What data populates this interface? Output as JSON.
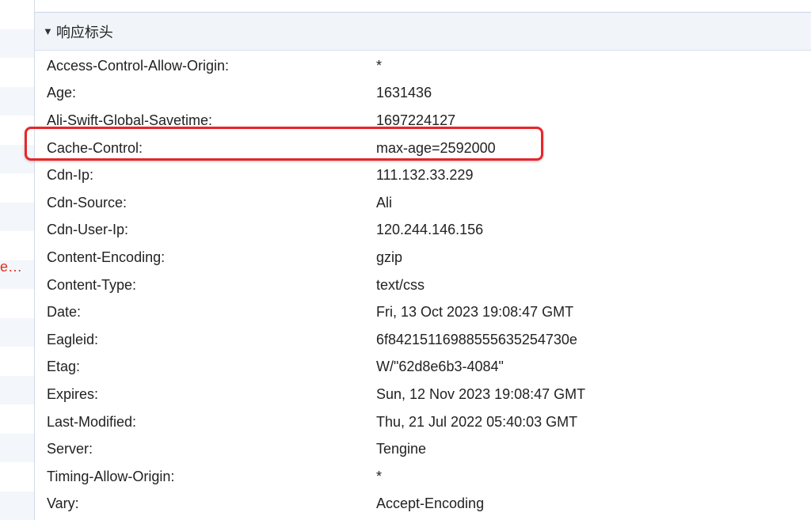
{
  "left_panel": {
    "truncated_text": "e…"
  },
  "section": {
    "title": "响应标头",
    "toggle_icon": "triangle-down-icon"
  },
  "headers": [
    {
      "name": "Access-Control-Allow-Origin:",
      "value": "*"
    },
    {
      "name": "Age:",
      "value": "1631436"
    },
    {
      "name": "Ali-Swift-Global-Savetime:",
      "value": "1697224127"
    },
    {
      "name": "Cache-Control:",
      "value": "max-age=2592000"
    },
    {
      "name": "Cdn-Ip:",
      "value": "111.132.33.229"
    },
    {
      "name": "Cdn-Source:",
      "value": "Ali"
    },
    {
      "name": "Cdn-User-Ip:",
      "value": "120.244.146.156"
    },
    {
      "name": "Content-Encoding:",
      "value": "gzip"
    },
    {
      "name": "Content-Type:",
      "value": "text/css"
    },
    {
      "name": "Date:",
      "value": "Fri, 13 Oct 2023 19:08:47 GMT"
    },
    {
      "name": "Eagleid:",
      "value": "6f842151169885556352547 30e"
    },
    {
      "name": "Etag:",
      "value": "W/\"62d8e6b3-4084\""
    },
    {
      "name": "Expires:",
      "value": "Sun, 12 Nov 2023 19:08:47 GMT"
    },
    {
      "name": "Last-Modified:",
      "value": "Thu, 21 Jul 2022 05:40:03 GMT"
    },
    {
      "name": "Server:",
      "value": "Tengine"
    },
    {
      "name": "Timing-Allow-Origin:",
      "value": "*"
    },
    {
      "name": "Vary:",
      "value": "Accept-Encoding"
    }
  ],
  "colors": {
    "highlight": "#e8262b",
    "header_bg": "#f1f5fa",
    "truncated_text": "#e0301e"
  }
}
